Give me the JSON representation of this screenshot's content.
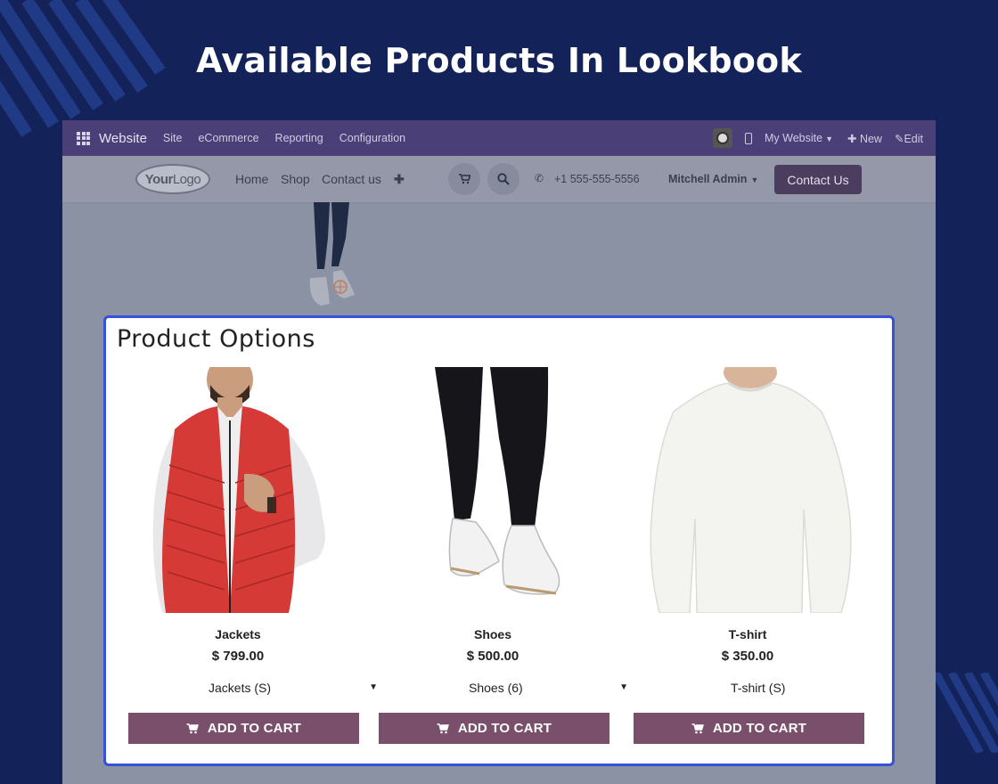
{
  "page_title": "Available Products In Lookbook",
  "odoo_bar": {
    "brand": "Website",
    "menus": [
      "Site",
      "eCommerce",
      "Reporting",
      "Configuration"
    ],
    "my_website": "My Website",
    "new_label": "New",
    "edit_label": "Edit"
  },
  "site_header": {
    "logo_bold": "Your",
    "logo_thin": "Logo",
    "nav": [
      "Home",
      "Shop",
      "Contact us"
    ],
    "phone": "+1 555-555-5556",
    "user": "Mitchell Admin",
    "contact_button": "Contact Us"
  },
  "modal": {
    "title": "Product Options",
    "products": [
      {
        "name": "Jackets",
        "price": "$ 799.00",
        "variant": "Jackets (S)",
        "button": "ADD TO CART"
      },
      {
        "name": "Shoes",
        "price": "$ 500.00",
        "variant": "Shoes (6)",
        "button": "ADD TO CART"
      },
      {
        "name": "T-shirt",
        "price": "$ 350.00",
        "variant": "T-shirt (S)",
        "button": "ADD TO CART"
      }
    ]
  },
  "colors": {
    "page_background": "#13235a",
    "odoo_bar": "#4b3f78",
    "modal_border": "#3552d8",
    "cart_button": "#7a4f6c",
    "contact_button": "#4a3d5e"
  }
}
